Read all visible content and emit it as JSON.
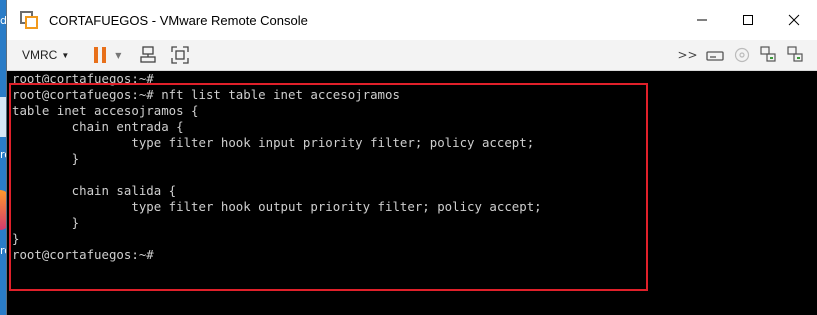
{
  "desktop": {
    "label_top": "dra",
    "label_mid": "ro",
    "label_bottom": "ro"
  },
  "window": {
    "title": "CORTAFUEGOS - VMware Remote Console"
  },
  "toolbar": {
    "menu_label": "VMRC",
    "icons": [
      "pause-icon",
      "send-ctrl-alt-del-icon",
      "fullscreen-icon",
      "more-icon",
      "removable-device-icon",
      "cd-icon",
      "network-adapter-icon",
      "network-adapter-2-icon"
    ]
  },
  "console": {
    "lines": [
      "root@cortafuegos:~#",
      "root@cortafuegos:~# nft list table inet accesojramos",
      "table inet accesojramos {",
      "        chain entrada {",
      "                type filter hook input priority filter; policy accept;",
      "        }",
      "",
      "        chain salida {",
      "                type filter hook output priority filter; policy accept;",
      "        }",
      "}",
      "root@cortafuegos:~#"
    ]
  },
  "colors": {
    "highlight": "#e0202a",
    "terminal_bg": "#000000",
    "terminal_fg": "#cfcfcf",
    "pause_orange": "#e8701a"
  }
}
